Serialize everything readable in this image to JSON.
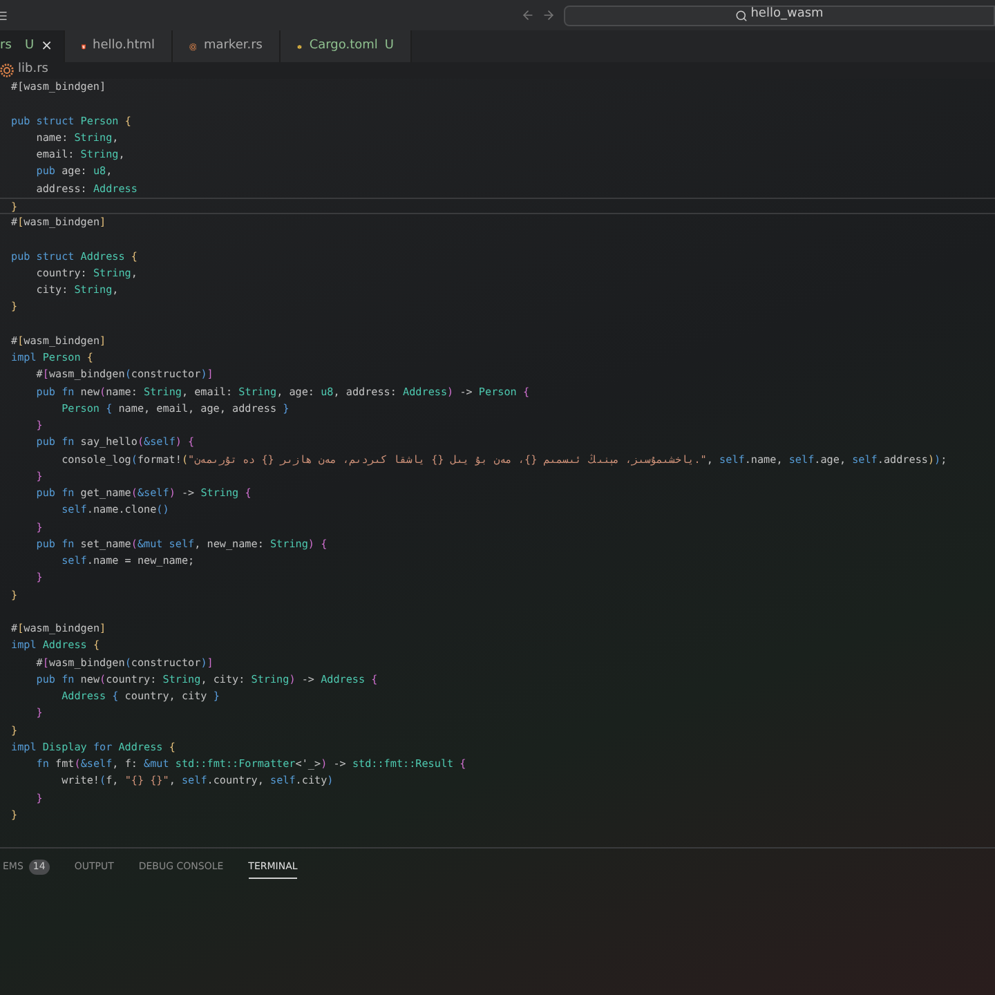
{
  "title_bar": {
    "search": "hello_wasm"
  },
  "tabs": [
    {
      "kind": "plain",
      "label": "rs",
      "status": "U",
      "close": "×",
      "selected": true
    },
    {
      "kind": "html",
      "label": "hello.html",
      "selected": false
    },
    {
      "kind": "rust",
      "label": "marker.rs",
      "selected": false
    },
    {
      "kind": "cargo",
      "label": "Cargo.toml",
      "status": "U",
      "selected": false
    }
  ],
  "breadcrumb": {
    "file": "lib.rs"
  },
  "editor": {
    "lines": [
      {
        "kind": "code",
        "current": false,
        "tokens": [
          {
            "text": "#[wasm_bindgen]",
            "kind": "p"
          }
        ]
      },
      {
        "kind": "blank"
      },
      {
        "kind": "code",
        "current": false,
        "tokens": [
          {
            "text": "pub struct ",
            "kind": "k"
          },
          {
            "text": "Person ",
            "kind": "t"
          },
          {
            "text": "{",
            "kind": "b1"
          }
        ]
      },
      {
        "kind": "code",
        "current": false,
        "tokens": [
          {
            "text": "    name: ",
            "kind": "p"
          },
          {
            "text": "String",
            "kind": "t"
          },
          {
            "text": ",",
            "kind": "p"
          }
        ]
      },
      {
        "kind": "code",
        "current": false,
        "tokens": [
          {
            "text": "    email: ",
            "kind": "p"
          },
          {
            "text": "String",
            "kind": "t"
          },
          {
            "text": ",",
            "kind": "p"
          }
        ]
      },
      {
        "kind": "code",
        "current": false,
        "tokens": [
          {
            "text": "    pub ",
            "kind": "k"
          },
          {
            "text": "age: ",
            "kind": "p"
          },
          {
            "text": "u8",
            "kind": "t"
          },
          {
            "text": ",",
            "kind": "p"
          }
        ]
      },
      {
        "kind": "code",
        "current": false,
        "tokens": [
          {
            "text": "    address: ",
            "kind": "p"
          },
          {
            "text": "Address",
            "kind": "t"
          }
        ]
      },
      {
        "kind": "code",
        "current": true,
        "tokens": [
          {
            "text": "}",
            "kind": "b1"
          }
        ]
      },
      {
        "kind": "code",
        "current": false,
        "tokens": [
          {
            "text": "#",
            "kind": "p"
          },
          {
            "text": "[",
            "kind": "b1"
          },
          {
            "text": "wasm_bindgen",
            "kind": "p"
          },
          {
            "text": "]",
            "kind": "b1"
          }
        ]
      },
      {
        "kind": "blank"
      },
      {
        "kind": "code",
        "current": false,
        "tokens": [
          {
            "text": "pub struct ",
            "kind": "k"
          },
          {
            "text": "Address ",
            "kind": "t"
          },
          {
            "text": "{",
            "kind": "b1"
          }
        ]
      },
      {
        "kind": "code",
        "current": false,
        "tokens": [
          {
            "text": "    country: ",
            "kind": "p"
          },
          {
            "text": "String",
            "kind": "t"
          },
          {
            "text": ",",
            "kind": "p"
          }
        ]
      },
      {
        "kind": "code",
        "current": false,
        "tokens": [
          {
            "text": "    city: ",
            "kind": "p"
          },
          {
            "text": "String",
            "kind": "t"
          },
          {
            "text": ",",
            "kind": "p"
          }
        ]
      },
      {
        "kind": "code",
        "current": false,
        "tokens": [
          {
            "text": "}",
            "kind": "b1"
          }
        ]
      },
      {
        "kind": "blank"
      },
      {
        "kind": "code",
        "current": false,
        "tokens": [
          {
            "text": "#",
            "kind": "p"
          },
          {
            "text": "[",
            "kind": "b1"
          },
          {
            "text": "wasm_bindgen",
            "kind": "p"
          },
          {
            "text": "]",
            "kind": "b1"
          }
        ]
      },
      {
        "kind": "code",
        "current": false,
        "tokens": [
          {
            "text": "impl ",
            "kind": "k"
          },
          {
            "text": "Person ",
            "kind": "t"
          },
          {
            "text": "{",
            "kind": "b1"
          }
        ]
      },
      {
        "kind": "code",
        "current": false,
        "tokens": [
          {
            "text": "    #",
            "kind": "p"
          },
          {
            "text": "[",
            "kind": "b2"
          },
          {
            "text": "wasm_bindgen",
            "kind": "p"
          },
          {
            "text": "(",
            "kind": "b3"
          },
          {
            "text": "constructor",
            "kind": "p"
          },
          {
            "text": ")",
            "kind": "b3"
          },
          {
            "text": "]",
            "kind": "b2"
          }
        ]
      },
      {
        "kind": "code",
        "current": false,
        "tokens": [
          {
            "text": "    pub fn ",
            "kind": "k"
          },
          {
            "text": "new",
            "kind": "p"
          },
          {
            "text": "(",
            "kind": "b2"
          },
          {
            "text": "name: ",
            "kind": "p"
          },
          {
            "text": "String",
            "kind": "t"
          },
          {
            "text": ", email: ",
            "kind": "p"
          },
          {
            "text": "String",
            "kind": "t"
          },
          {
            "text": ", age: ",
            "kind": "p"
          },
          {
            "text": "u8",
            "kind": "t"
          },
          {
            "text": ", address: ",
            "kind": "p"
          },
          {
            "text": "Address",
            "kind": "t"
          },
          {
            "text": ")",
            "kind": "b2"
          },
          {
            "text": " -> ",
            "kind": "p"
          },
          {
            "text": "Person ",
            "kind": "t"
          },
          {
            "text": "{",
            "kind": "b2"
          }
        ]
      },
      {
        "kind": "code",
        "current": false,
        "tokens": [
          {
            "text": "        Person ",
            "kind": "t"
          },
          {
            "text": "{",
            "kind": "b3"
          },
          {
            "text": " name, email, age, address ",
            "kind": "p"
          },
          {
            "text": "}",
            "kind": "b3"
          }
        ]
      },
      {
        "kind": "code",
        "current": false,
        "tokens": [
          {
            "text": "    }",
            "kind": "b2"
          }
        ]
      },
      {
        "kind": "code",
        "current": false,
        "tokens": [
          {
            "text": "    pub fn ",
            "kind": "k"
          },
          {
            "text": "say_hello",
            "kind": "p"
          },
          {
            "text": "(",
            "kind": "b2"
          },
          {
            "text": "&self",
            "kind": "k"
          },
          {
            "text": ") {",
            "kind": "b2"
          }
        ]
      },
      {
        "kind": "code",
        "current": false,
        "tokens": [
          {
            "text": "        console_log",
            "kind": "p"
          },
          {
            "text": "(",
            "kind": "b3"
          },
          {
            "text": "format!",
            "kind": "p"
          },
          {
            "text": "(",
            "kind": "b1"
          },
          {
            "text": "\"ياخشىمۇسىز، مېنىڭ ئىسمىم {}، مەن بۇ يىل {} ياشقا كىردىم، مەن ھازىر {} دە تۇرىمەن.\"",
            "kind": "s"
          },
          {
            "text": ", ",
            "kind": "p"
          },
          {
            "text": "self",
            "kind": "k"
          },
          {
            "text": ".name, ",
            "kind": "p"
          },
          {
            "text": "self",
            "kind": "k"
          },
          {
            "text": ".age, ",
            "kind": "p"
          },
          {
            "text": "self",
            "kind": "k"
          },
          {
            "text": ".address",
            "kind": "p"
          },
          {
            "text": ")",
            "kind": "b1"
          },
          {
            "text": ")",
            "kind": "b3"
          },
          {
            "text": ";",
            "kind": "p"
          }
        ]
      },
      {
        "kind": "code",
        "current": false,
        "tokens": [
          {
            "text": "    }",
            "kind": "b2"
          }
        ]
      },
      {
        "kind": "code",
        "current": false,
        "tokens": [
          {
            "text": "    pub fn ",
            "kind": "k"
          },
          {
            "text": "get_name",
            "kind": "p"
          },
          {
            "text": "(",
            "kind": "b2"
          },
          {
            "text": "&self",
            "kind": "k"
          },
          {
            "text": ")",
            "kind": "b2"
          },
          {
            "text": " -> ",
            "kind": "p"
          },
          {
            "text": "String ",
            "kind": "t"
          },
          {
            "text": "{",
            "kind": "b2"
          }
        ]
      },
      {
        "kind": "code",
        "current": false,
        "tokens": [
          {
            "text": "        self",
            "kind": "k"
          },
          {
            "text": ".name.clone",
            "kind": "p"
          },
          {
            "text": "()",
            "kind": "b3"
          }
        ]
      },
      {
        "kind": "code",
        "current": false,
        "tokens": [
          {
            "text": "    }",
            "kind": "b2"
          }
        ]
      },
      {
        "kind": "code",
        "current": false,
        "tokens": [
          {
            "text": "    pub fn ",
            "kind": "k"
          },
          {
            "text": "set_name",
            "kind": "p"
          },
          {
            "text": "(",
            "kind": "b2"
          },
          {
            "text": "&mut self",
            "kind": "k"
          },
          {
            "text": ", new_name: ",
            "kind": "p"
          },
          {
            "text": "String",
            "kind": "t"
          },
          {
            "text": ") {",
            "kind": "b2"
          }
        ]
      },
      {
        "kind": "code",
        "current": false,
        "tokens": [
          {
            "text": "        self",
            "kind": "k"
          },
          {
            "text": ".name = new_name;",
            "kind": "p"
          }
        ]
      },
      {
        "kind": "code",
        "current": false,
        "tokens": [
          {
            "text": "    }",
            "kind": "b2"
          }
        ]
      },
      {
        "kind": "code",
        "current": false,
        "tokens": [
          {
            "text": "}",
            "kind": "b1"
          }
        ]
      },
      {
        "kind": "blank"
      },
      {
        "kind": "code",
        "current": false,
        "tokens": [
          {
            "text": "#",
            "kind": "p"
          },
          {
            "text": "[",
            "kind": "b1"
          },
          {
            "text": "wasm_bindgen",
            "kind": "p"
          },
          {
            "text": "]",
            "kind": "b1"
          }
        ]
      },
      {
        "kind": "code",
        "current": false,
        "tokens": [
          {
            "text": "impl ",
            "kind": "k"
          },
          {
            "text": "Address ",
            "kind": "t"
          },
          {
            "text": "{",
            "kind": "b1"
          }
        ]
      },
      {
        "kind": "code",
        "current": false,
        "tokens": [
          {
            "text": "    #",
            "kind": "p"
          },
          {
            "text": "[",
            "kind": "b2"
          },
          {
            "text": "wasm_bindgen",
            "kind": "p"
          },
          {
            "text": "(",
            "kind": "b3"
          },
          {
            "text": "constructor",
            "kind": "p"
          },
          {
            "text": ")",
            "kind": "b3"
          },
          {
            "text": "]",
            "kind": "b2"
          }
        ]
      },
      {
        "kind": "code",
        "current": false,
        "tokens": [
          {
            "text": "    pub fn ",
            "kind": "k"
          },
          {
            "text": "new",
            "kind": "p"
          },
          {
            "text": "(",
            "kind": "b2"
          },
          {
            "text": "country: ",
            "kind": "p"
          },
          {
            "text": "String",
            "kind": "t"
          },
          {
            "text": ", city: ",
            "kind": "p"
          },
          {
            "text": "String",
            "kind": "t"
          },
          {
            "text": ")",
            "kind": "b2"
          },
          {
            "text": " -> ",
            "kind": "p"
          },
          {
            "text": "Address ",
            "kind": "t"
          },
          {
            "text": "{",
            "kind": "b2"
          }
        ]
      },
      {
        "kind": "code",
        "current": false,
        "tokens": [
          {
            "text": "        Address ",
            "kind": "t"
          },
          {
            "text": "{",
            "kind": "b3"
          },
          {
            "text": " country, city ",
            "kind": "p"
          },
          {
            "text": "}",
            "kind": "b3"
          }
        ]
      },
      {
        "kind": "code",
        "current": false,
        "tokens": [
          {
            "text": "    }",
            "kind": "b2"
          }
        ]
      },
      {
        "kind": "code",
        "current": false,
        "tokens": [
          {
            "text": "}",
            "kind": "b1"
          }
        ]
      },
      {
        "kind": "code",
        "current": false,
        "tokens": [
          {
            "text": "impl ",
            "kind": "k"
          },
          {
            "text": "Display ",
            "kind": "t"
          },
          {
            "text": "for ",
            "kind": "k"
          },
          {
            "text": "Address ",
            "kind": "t"
          },
          {
            "text": "{",
            "kind": "b1"
          }
        ]
      },
      {
        "kind": "code",
        "current": false,
        "tokens": [
          {
            "text": "    fn ",
            "kind": "k"
          },
          {
            "text": "fmt",
            "kind": "p"
          },
          {
            "text": "(",
            "kind": "b2"
          },
          {
            "text": "&self",
            "kind": "k"
          },
          {
            "text": ", f: ",
            "kind": "p"
          },
          {
            "text": "&mut ",
            "kind": "k"
          },
          {
            "text": "std::fmt::Formatter",
            "kind": "t"
          },
          {
            "text": "<'_>",
            "kind": "p"
          },
          {
            "text": ")",
            "kind": "b2"
          },
          {
            "text": " -> ",
            "kind": "p"
          },
          {
            "text": "std::fmt::Result ",
            "kind": "t"
          },
          {
            "text": "{",
            "kind": "b2"
          }
        ]
      },
      {
        "kind": "code",
        "current": false,
        "tokens": [
          {
            "text": "        write!",
            "kind": "p"
          },
          {
            "text": "(",
            "kind": "b3"
          },
          {
            "text": "f, ",
            "kind": "p"
          },
          {
            "text": "\"{} {}\"",
            "kind": "s"
          },
          {
            "text": ", ",
            "kind": "p"
          },
          {
            "text": "self",
            "kind": "k"
          },
          {
            "text": ".country, ",
            "kind": "p"
          },
          {
            "text": "self",
            "kind": "k"
          },
          {
            "text": ".city",
            "kind": "p"
          },
          {
            "text": ")",
            "kind": "b3"
          }
        ]
      },
      {
        "kind": "code",
        "current": false,
        "tokens": [
          {
            "text": "    }",
            "kind": "b2"
          }
        ]
      },
      {
        "kind": "code",
        "current": false,
        "tokens": [
          {
            "text": "}",
            "kind": "b1"
          }
        ]
      }
    ]
  },
  "panel": {
    "tabs": [
      {
        "label": "EMS",
        "count": "14",
        "selected": false
      },
      {
        "label": "OUTPUT",
        "selected": false
      },
      {
        "label": "DEBUG CONSOLE",
        "selected": false
      },
      {
        "label": "TERMINAL",
        "selected": true
      }
    ]
  }
}
